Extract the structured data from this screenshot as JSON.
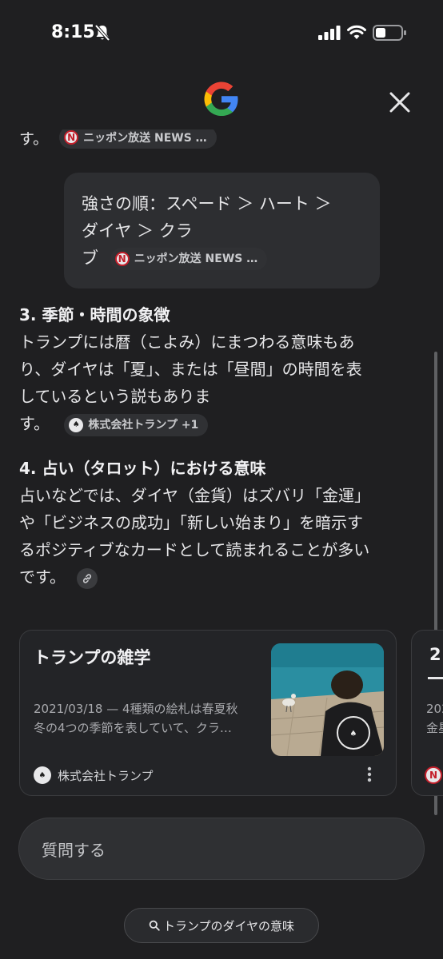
{
  "status_bar": {
    "time": "8:15"
  },
  "header": {
    "logo_icon": "google-g-logo",
    "close_icon": "close-icon"
  },
  "content": {
    "clipped_line": {
      "text": "す。",
      "chip": {
        "source": "ニッポン放送 NEWS …",
        "icon": "nippon-housou-logo"
      }
    },
    "quote": {
      "line1": "強さの順：スペード ＞ ハート ＞",
      "line2": "ダイヤ ＞ クラ",
      "line3": "ブ",
      "chip": {
        "source": "ニッポン放送 NEWS …",
        "icon": "nippon-housou-logo"
      }
    },
    "section3": {
      "heading": "3. 季節・時間の象徴",
      "line1": "トランプには暦（こよみ）にまつわる意味もあ",
      "line2": "り、ダイヤは「夏」、または「昼間」の時間を表",
      "line3": "しているという説もありま",
      "line4": "す。",
      "chip": {
        "source": "株式会社トランプ +1",
        "icon": "trump-company-logo"
      }
    },
    "section4": {
      "heading": "4. 占い（タロット）における意味",
      "line1": "占いなどでは、ダイヤ（金貨）はズバリ「金運」",
      "line2": "や「ビジネスの成功」「新しい始まり」を暗示す",
      "line3": "るポジティブなカードとして読まれることが多い",
      "line4": "です。",
      "link_icon": "link-icon"
    }
  },
  "cards": [
    {
      "title": "トランプの雑学",
      "snippet_line1": "2021/03/18 — 4種類の絵札は春夏秋",
      "snippet_line2": "冬の4つの季節を表していて、クラ…",
      "source": "株式会社トランプ",
      "thumb_icon": "photo-man-by-sea-with-seagull"
    },
    {
      "title_peek": "2",
      "line1_peek": "202",
      "line2_peek": "金星"
    }
  ],
  "ask": {
    "placeholder": "質問する"
  },
  "suggestion": {
    "label": "トランプのダイヤの意味",
    "icon": "search-icon"
  },
  "colors": {
    "background": "#1f1f21",
    "surface": "#2d2e31",
    "chip": "#303134",
    "text": "#e6e6e8",
    "muted": "#a9aaae"
  }
}
